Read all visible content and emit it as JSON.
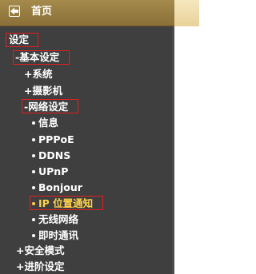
{
  "header": {
    "home_icon": "back-arrow-icon",
    "home_label": "首页"
  },
  "nav": {
    "settings": "设定",
    "basic_settings": "-基本设定",
    "system": "+系统",
    "camera": "+摄影机",
    "network_settings": "-网络设定",
    "info": "信息",
    "pppoe": "PPPoE",
    "ddns": "DDNS",
    "upnp": "UPnP",
    "bonjour": "Bonjour",
    "ip_notify": "IP 位置通知",
    "wireless": "无线网络",
    "instant_messaging": "即时通讯",
    "security_mode": "+安全模式",
    "advanced_settings": "+进阶设定"
  },
  "colors": {
    "sidebar_bg": "#3f3f3f",
    "header_bg": "#9b8144",
    "highlight_border": "#e02020",
    "selected_text": "#ffd24a"
  }
}
